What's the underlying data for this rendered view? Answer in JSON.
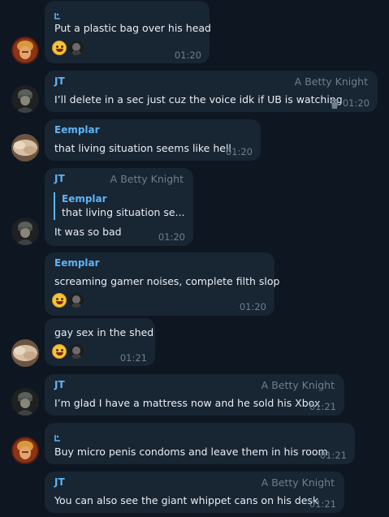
{
  "messages": [
    {
      "sender": "⭐",
      "text": "Put a plastic bag over his head",
      "time": "01:20",
      "reactions": [
        "🤣",
        "avatar"
      ]
    },
    {
      "sender": "JT",
      "role": "A Betty Knight",
      "text": "I’ll delete in a sec just cuz the voice idk if UB is watching",
      "time": "01:20"
    },
    {
      "sender": "Eemplar",
      "text": "that living situation seems like hell",
      "time": "01:20"
    },
    {
      "sender": "JT",
      "role": "A Betty Knight",
      "reply": {
        "sender": "Eemplar",
        "text": "that living situation se..."
      },
      "text": "It was so bad",
      "time": "01:20"
    },
    {
      "sender": "Eemplar",
      "text": "screaming gamer noises, complete filth slop",
      "time": "01:20",
      "reactions": [
        "🤣",
        "avatar"
      ]
    },
    {
      "text": "gay sex in the shed",
      "time": "01:21",
      "reactions": [
        "🤣",
        "avatar"
      ]
    },
    {
      "sender": "JT",
      "role": "A Betty Knight",
      "text": "I’m glad I have a mattress now and he sold his Xbox",
      "time": "01:21"
    },
    {
      "sender": "⭐",
      "text": "Buy micro penis condoms and leave them in his room",
      "time": "01:21"
    },
    {
      "sender": "JT",
      "role": "A Betty Knight",
      "text": "You can also see the giant whippet cans on his desk",
      "time": "01:21"
    }
  ]
}
